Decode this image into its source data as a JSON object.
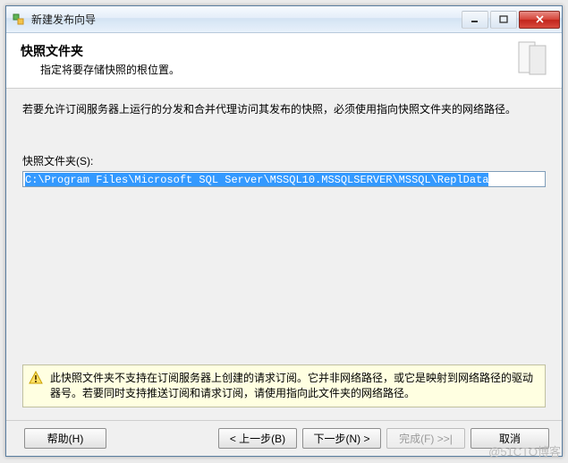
{
  "titlebar": {
    "title": "新建发布向导"
  },
  "header": {
    "title": "快照文件夹",
    "subtitle": "指定将要存储快照的根位置。"
  },
  "content": {
    "description": "若要允许订阅服务器上运行的分发和合并代理访问其发布的快照，必须使用指向快照文件夹的网络路径。",
    "field_label": "快照文件夹(S):",
    "field_value": "C:\\Program Files\\Microsoft SQL Server\\MSSQL10.MSSQLSERVER\\MSSQL\\ReplData"
  },
  "warning": {
    "text": "此快照文件夹不支持在订阅服务器上创建的请求订阅。它并非网络路径，或它是映射到网络路径的驱动器号。若要同时支持推送订阅和请求订阅，请使用指向此文件夹的网络路径。"
  },
  "footer": {
    "help": "帮助(H)",
    "back": "< 上一步(B)",
    "next": "下一步(N) >",
    "finish": "完成(F) >>|",
    "cancel": "取消"
  },
  "watermark": "@51CTO博客"
}
